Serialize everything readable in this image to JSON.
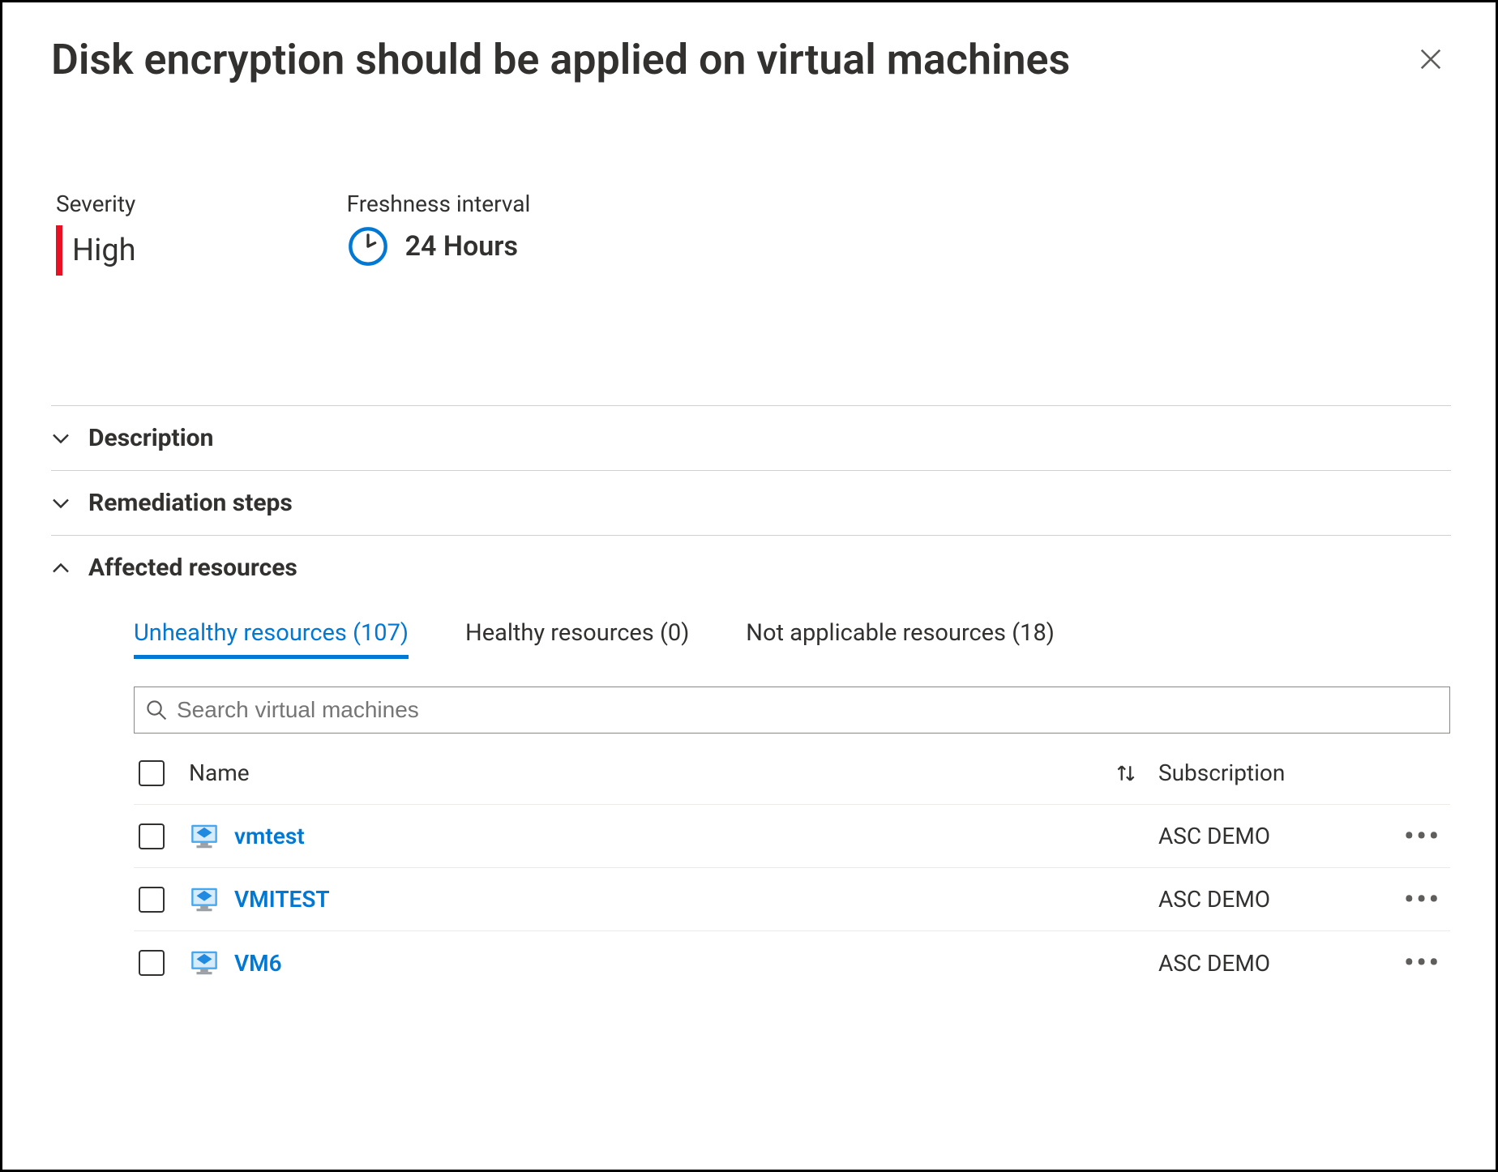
{
  "header": {
    "title": "Disk encryption should be applied on virtual machines"
  },
  "summary": {
    "severity_label": "Severity",
    "severity_value": "High",
    "freshness_label": "Freshness interval",
    "freshness_value": "24 Hours"
  },
  "sections": {
    "description": "Description",
    "remediation": "Remediation steps",
    "affected": "Affected resources"
  },
  "tabs": {
    "unhealthy": "Unhealthy resources (107)",
    "healthy": "Healthy resources (0)",
    "na": "Not applicable resources (18)"
  },
  "search": {
    "placeholder": "Search virtual machines"
  },
  "table": {
    "col_name": "Name",
    "col_sub": "Subscription",
    "rows": [
      {
        "name": "vmtest",
        "subscription": "ASC DEMO"
      },
      {
        "name": "VMITEST",
        "subscription": "ASC DEMO"
      },
      {
        "name": "VM6",
        "subscription": "ASC DEMO"
      }
    ]
  }
}
